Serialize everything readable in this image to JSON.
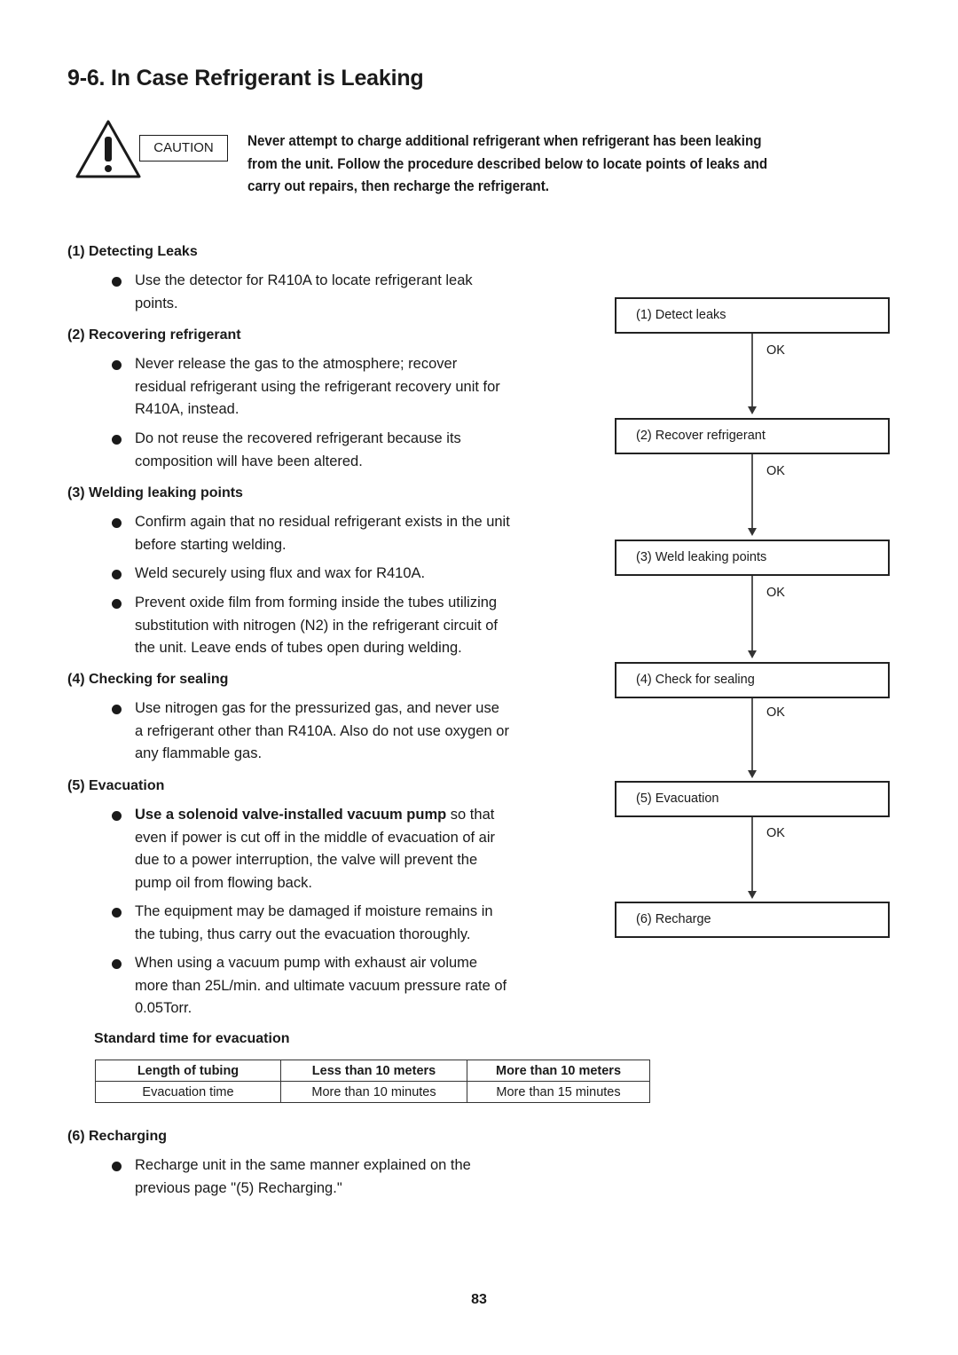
{
  "title": "9-6.  In Case Refrigerant is Leaking",
  "caution": {
    "label": "CAUTION",
    "lines": [
      "Never attempt to charge additional refrigerant when refrigerant has been leaking",
      "from the unit. Follow the procedure described below to locate points of leaks and",
      "carry out repairs, then recharge the refrigerant."
    ]
  },
  "sections": [
    {
      "heading": "(1) Detecting Leaks",
      "bullets": [
        [
          "Use the detector for R410A to locate refrigerant leak",
          "points."
        ]
      ]
    },
    {
      "heading": "(2) Recovering refrigerant",
      "bullets": [
        [
          "Never release the gas to the atmosphere; recover",
          "residual refrigerant using the refrigerant recovery unit for",
          "R410A, instead."
        ],
        [
          "Do not reuse the recovered refrigerant because its",
          "composition will have been altered."
        ]
      ]
    },
    {
      "heading": "(3) Welding leaking points",
      "bullets": [
        [
          "Confirm again that no residual refrigerant exists in the unit",
          "before starting welding."
        ],
        [
          "Weld securely using flux and wax for R410A."
        ],
        [
          "Prevent oxide film from forming inside the tubes utilizing",
          "substitution with nitrogen (N2) in the refrigerant circuit of",
          "the unit. Leave ends of tubes open during welding."
        ]
      ]
    },
    {
      "heading": "(4) Checking for sealing",
      "bullets": [
        [
          "Use nitrogen gas for the pressurized gas, and never use",
          "a refrigerant other than R410A. Also do not use oxygen or",
          "any flammable gas."
        ]
      ]
    },
    {
      "heading": "(5) Evacuation",
      "bullets": [
        [
          "so that",
          "even if power is cut off in the middle of evacuation of air",
          "due to a power interruption, the valve will prevent the",
          "pump oil from flowing back."
        ],
        [
          "The equipment may be damaged if moisture remains in",
          "the tubing, thus carry out the evacuation thoroughly."
        ],
        [
          "When using a vacuum pump with exhaust air volume",
          "more than 25L/min. and ultimate vacuum pressure rate of",
          "0.05Torr."
        ]
      ],
      "bold_lead": "Use a solenoid valve-installed vacuum pump"
    },
    {
      "heading": "(6) Recharging",
      "bullets": [
        [
          "Recharge unit in the same manner explained on the",
          "previous page \"(5) Recharging.\""
        ]
      ]
    }
  ],
  "flowchart": {
    "steps": [
      "(1) Detect leaks",
      "(2) Recover refrigerant",
      "(3) Weld leaking points",
      "(4) Check for sealing",
      "(5) Evacuation",
      "(6) Recharge"
    ],
    "connector_label": "OK"
  },
  "evacuation_table": {
    "title": "Standard time for evacuation",
    "header": [
      "Length of tubing",
      "Less than 10 meters",
      "More than 10 meters"
    ],
    "row": [
      "Evacuation time",
      "More than 10 minutes",
      "More than 15 minutes"
    ]
  },
  "page_number": "83"
}
